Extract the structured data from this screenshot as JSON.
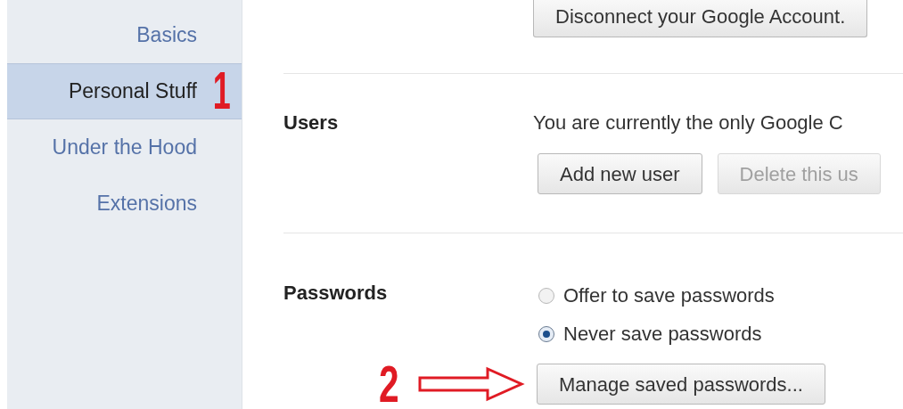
{
  "sidebar": {
    "items": [
      {
        "label": "Basics",
        "selected": false
      },
      {
        "label": "Personal Stuff",
        "selected": true,
        "annotation": "1"
      },
      {
        "label": "Under the Hood",
        "selected": false
      },
      {
        "label": "Extensions",
        "selected": false
      }
    ]
  },
  "account": {
    "button": "Disconnect your Google Account."
  },
  "users": {
    "label": "Users",
    "text": "You are currently the only Google C",
    "buttons": [
      {
        "label": "Add new user",
        "disabled": false
      },
      {
        "label": "Delete this us",
        "disabled": true
      }
    ]
  },
  "passwords": {
    "label": "Passwords",
    "options": [
      {
        "label": "Offer to save passwords",
        "selected": false
      },
      {
        "label": "Never save passwords",
        "selected": true
      }
    ],
    "button": "Manage saved passwords...",
    "annotation": "2"
  }
}
